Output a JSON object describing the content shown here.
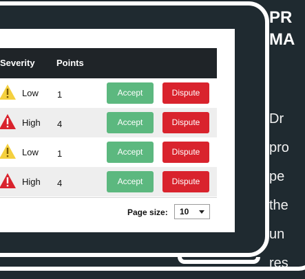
{
  "headline": {
    "line1": "PR",
    "line2": "MA"
  },
  "body_copy": {
    "line1": "Dr",
    "line2": "pro",
    "line3": "pe",
    "line4": "the",
    "line5": "un",
    "line6": "res"
  },
  "table": {
    "columns": {
      "severity": "Severity",
      "points": "Points"
    },
    "rows": [
      {
        "severity": "Low",
        "icon": "yellow-warning-icon",
        "points": "1",
        "accept": "Accept",
        "dispute": "Dispute"
      },
      {
        "severity": "High",
        "icon": "red-warning-icon",
        "points": "4",
        "accept": "Accept",
        "dispute": "Dispute"
      },
      {
        "severity": "Low",
        "icon": "yellow-warning-icon",
        "points": "1",
        "accept": "Accept",
        "dispute": "Dispute"
      },
      {
        "severity": "High",
        "icon": "red-warning-icon",
        "points": "4",
        "accept": "Accept",
        "dispute": "Dispute"
      }
    ]
  },
  "pager": {
    "label": "Page size:",
    "value": "10"
  },
  "colors": {
    "background": "#1f2a30",
    "header": "#1f2428",
    "accept": "#5cb87f",
    "dispute": "#d9232d",
    "low_icon": "#f4d03f",
    "high_icon": "#d9232d"
  }
}
